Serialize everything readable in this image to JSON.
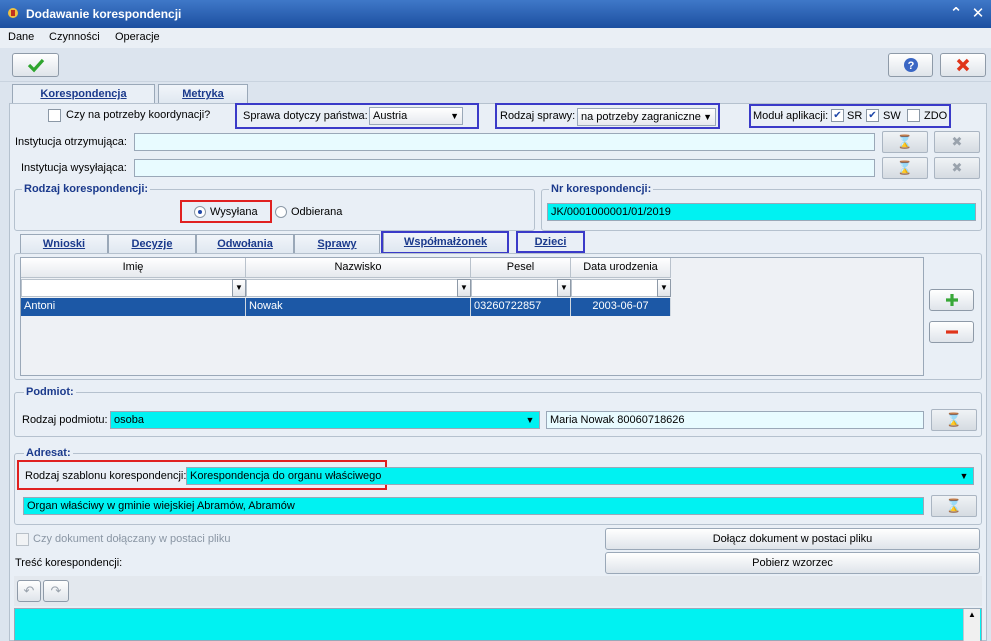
{
  "window": {
    "title": "Dodawanie korespondencji"
  },
  "menu": {
    "items": [
      "Dane",
      "Czynności",
      "Operacje"
    ]
  },
  "tabs": [
    {
      "label": "Korespondencja"
    },
    {
      "label": "Metryka"
    }
  ],
  "top": {
    "koord_checkbox_label": "Czy na potrzeby koordynacji?",
    "sprawa_panstwa_label": "Sprawa dotyczy państwa:",
    "sprawa_panstwa_value": "Austria",
    "rodzaj_sprawy_label": "Rodzaj sprawy:",
    "rodzaj_sprawy_value": "na potrzeby zagraniczne",
    "modul_label": "Moduł aplikacji:",
    "modul_sr": "SR",
    "modul_sw": "SW",
    "modul_zdo": "ZDO",
    "instytucja_otrzymujaca_label": "Instytucja otrzymująca:",
    "instytucja_wysylajaca_label": "Instytucja wysyłająca:"
  },
  "rodzaj_korespondencji": {
    "title": "Rodzaj korespondencji:",
    "opt_wysylana": "Wysyłana",
    "opt_odbierana": "Odbierana"
  },
  "nr_korespondencji": {
    "title": "Nr korespondencji:",
    "value": "JK/0001000001/01/2019"
  },
  "subtabs": [
    {
      "label": "Wnioski"
    },
    {
      "label": "Decyzje"
    },
    {
      "label": "Odwołania"
    },
    {
      "label": "Sprawy"
    },
    {
      "label": "Współmałżonek"
    },
    {
      "label": "Dzieci"
    }
  ],
  "grid": {
    "columns": [
      "Imię",
      "Nazwisko",
      "Pesel",
      "Data urodzenia"
    ],
    "rows": [
      {
        "imie": "Antoni",
        "nazwisko": "Nowak",
        "pesel": "03260722857",
        "data": "2003-06-07"
      }
    ]
  },
  "podmiot": {
    "title": "Podmiot:",
    "rodzaj_label": "Rodzaj podmiotu:",
    "rodzaj_value": "osoba",
    "name_value": "Maria Nowak 80060718626"
  },
  "adresat": {
    "title": "Adresat:",
    "szablon_label": "Rodzaj szablonu korespondencji:",
    "szablon_value": "Korespondencja do organu właściwego",
    "organ_value": "Organ właściwy w gminie wiejskiej Abramów, Abramów"
  },
  "bottom": {
    "dokument_checkbox_label": "Czy dokument dołączany w postaci pliku",
    "dolacz_button": "Dołącz dokument w postaci pliku",
    "tresc_label": "Treść korespondencji:",
    "pobierz_button": "Pobierz wzorzec"
  },
  "colors": {
    "accent_cyan": "#00f2f2",
    "selection_blue": "#1c58a6",
    "titlebar_blue": "#2a5fb4",
    "highlight_blue_frame": "#3a3ac8",
    "highlight_red_frame": "#e02020"
  }
}
